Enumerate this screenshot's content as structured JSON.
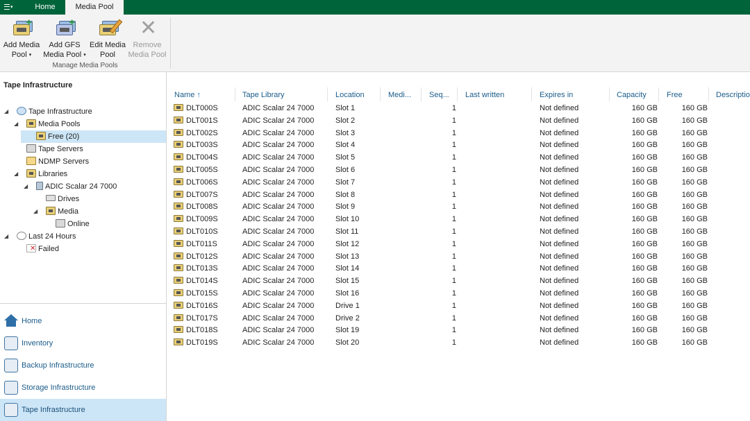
{
  "tabs": {
    "home": "Home",
    "media_pool": "Media Pool"
  },
  "ribbon": {
    "add_media_pool": [
      "Add Media",
      "Pool"
    ],
    "add_gfs_media_pool": [
      "Add GFS",
      "Media Pool"
    ],
    "edit_media_pool": [
      "Edit Media",
      "Pool"
    ],
    "remove_media_pool": [
      "Remove",
      "Media Pool"
    ],
    "group_label": "Manage Media Pools"
  },
  "left_panel": {
    "title": "Tape Infrastructure",
    "tree": {
      "tape_infrastructure": "Tape Infrastructure",
      "media_pools": "Media Pools",
      "free": "Free (20)",
      "tape_servers": "Tape Servers",
      "ndmp_servers": "NDMP Servers",
      "libraries": "Libraries",
      "adic": "ADIC Scalar 24 7000",
      "drives": "Drives",
      "media": "Media",
      "online": "Online",
      "last_24_hours": "Last 24 Hours",
      "failed": "Failed"
    }
  },
  "nav": {
    "home": "Home",
    "inventory": "Inventory",
    "backup_infrastructure": "Backup Infrastructure",
    "storage_infrastructure": "Storage Infrastructure",
    "tape_infrastructure": "Tape Infrastructure"
  },
  "columns": {
    "name": "Name",
    "tape_library": "Tape Library",
    "location": "Location",
    "media": "Medi...",
    "seq": "Seq...",
    "last_written": "Last written",
    "expires_in": "Expires in",
    "capacity": "Capacity",
    "free": "Free",
    "description": "Description"
  },
  "rows": [
    {
      "name": "DLT000S",
      "library": "ADIC Scalar 24 7000",
      "location": "Slot 1",
      "seq": "1",
      "expires": "Not defined",
      "capacity": "160 GB",
      "free": "160 GB"
    },
    {
      "name": "DLT001S",
      "library": "ADIC Scalar 24 7000",
      "location": "Slot 2",
      "seq": "1",
      "expires": "Not defined",
      "capacity": "160 GB",
      "free": "160 GB"
    },
    {
      "name": "DLT002S",
      "library": "ADIC Scalar 24 7000",
      "location": "Slot 3",
      "seq": "1",
      "expires": "Not defined",
      "capacity": "160 GB",
      "free": "160 GB"
    },
    {
      "name": "DLT003S",
      "library": "ADIC Scalar 24 7000",
      "location": "Slot 4",
      "seq": "1",
      "expires": "Not defined",
      "capacity": "160 GB",
      "free": "160 GB"
    },
    {
      "name": "DLT004S",
      "library": "ADIC Scalar 24 7000",
      "location": "Slot 5",
      "seq": "1",
      "expires": "Not defined",
      "capacity": "160 GB",
      "free": "160 GB"
    },
    {
      "name": "DLT005S",
      "library": "ADIC Scalar 24 7000",
      "location": "Slot 6",
      "seq": "1",
      "expires": "Not defined",
      "capacity": "160 GB",
      "free": "160 GB"
    },
    {
      "name": "DLT006S",
      "library": "ADIC Scalar 24 7000",
      "location": "Slot 7",
      "seq": "1",
      "expires": "Not defined",
      "capacity": "160 GB",
      "free": "160 GB"
    },
    {
      "name": "DLT007S",
      "library": "ADIC Scalar 24 7000",
      "location": "Slot 8",
      "seq": "1",
      "expires": "Not defined",
      "capacity": "160 GB",
      "free": "160 GB"
    },
    {
      "name": "DLT008S",
      "library": "ADIC Scalar 24 7000",
      "location": "Slot 9",
      "seq": "1",
      "expires": "Not defined",
      "capacity": "160 GB",
      "free": "160 GB"
    },
    {
      "name": "DLT009S",
      "library": "ADIC Scalar 24 7000",
      "location": "Slot 10",
      "seq": "1",
      "expires": "Not defined",
      "capacity": "160 GB",
      "free": "160 GB"
    },
    {
      "name": "DLT010S",
      "library": "ADIC Scalar 24 7000",
      "location": "Slot 11",
      "seq": "1",
      "expires": "Not defined",
      "capacity": "160 GB",
      "free": "160 GB"
    },
    {
      "name": "DLT011S",
      "library": "ADIC Scalar 24 7000",
      "location": "Slot 12",
      "seq": "1",
      "expires": "Not defined",
      "capacity": "160 GB",
      "free": "160 GB"
    },
    {
      "name": "DLT012S",
      "library": "ADIC Scalar 24 7000",
      "location": "Slot 13",
      "seq": "1",
      "expires": "Not defined",
      "capacity": "160 GB",
      "free": "160 GB"
    },
    {
      "name": "DLT013S",
      "library": "ADIC Scalar 24 7000",
      "location": "Slot 14",
      "seq": "1",
      "expires": "Not defined",
      "capacity": "160 GB",
      "free": "160 GB"
    },
    {
      "name": "DLT014S",
      "library": "ADIC Scalar 24 7000",
      "location": "Slot 15",
      "seq": "1",
      "expires": "Not defined",
      "capacity": "160 GB",
      "free": "160 GB"
    },
    {
      "name": "DLT015S",
      "library": "ADIC Scalar 24 7000",
      "location": "Slot 16",
      "seq": "1",
      "expires": "Not defined",
      "capacity": "160 GB",
      "free": "160 GB"
    },
    {
      "name": "DLT016S",
      "library": "ADIC Scalar 24 7000",
      "location": "Drive 1",
      "seq": "1",
      "expires": "Not defined",
      "capacity": "160 GB",
      "free": "160 GB"
    },
    {
      "name": "DLT017S",
      "library": "ADIC Scalar 24 7000",
      "location": "Drive 2",
      "seq": "1",
      "expires": "Not defined",
      "capacity": "160 GB",
      "free": "160 GB"
    },
    {
      "name": "DLT018S",
      "library": "ADIC Scalar 24 7000",
      "location": "Slot 19",
      "seq": "1",
      "expires": "Not defined",
      "capacity": "160 GB",
      "free": "160 GB"
    },
    {
      "name": "DLT019S",
      "library": "ADIC Scalar 24 7000",
      "location": "Slot 20",
      "seq": "1",
      "expires": "Not defined",
      "capacity": "160 GB",
      "free": "160 GB"
    }
  ],
  "colors": {
    "tabbar": "#00643a",
    "selection": "#cde6f7",
    "link": "#1a5b8a"
  }
}
